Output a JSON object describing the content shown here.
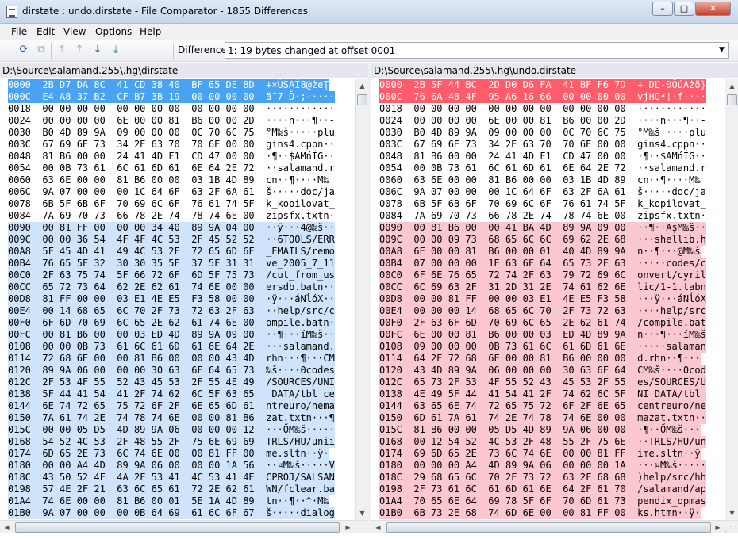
{
  "window": {
    "title": "dirstate : undo.dirstate - File Comparator - 1855 Differences",
    "minimize": "–",
    "maximize": "□",
    "close": "✕"
  },
  "menu": [
    "File",
    "Edit",
    "View",
    "Options",
    "Help"
  ],
  "toolbar": {
    "icons": [
      "refresh-icon",
      "copy-icon",
      "first-difference-icon",
      "previous-difference-icon",
      "next-difference-icon",
      "last-difference-icon"
    ],
    "difference_label": "Difference",
    "difference_value": "1: 19 bytes changed at offset 0001"
  },
  "left": {
    "path": "D:\\Source\\salamand.255\\.hg\\dirstate",
    "rows": [
      "0000  2B D7 DA 8C  41 CD 38 40  BF 65 DE 8D  +×ÚŚAÍ8@żeŢ",
      "000C  E4 A8 37 B2  CF B7 3B 19  00 00 00 00  ä¨7 Ď·;·····",
      "0018  00 00 00 00  00 00 00 00  00 00 00 00  ············",
      "0024  00 00 00 00  6E 00 00 81  B6 00 00 2D  ····n···¶··-",
      "0030  B0 4D 89 9A  09 00 00 00  0C 70 6C 75  °M‰š·····plu",
      "003C  67 69 6E 73  34 2E 63 70  70 6E 00 00  gins4.cppn··",
      "0048  81 B6 00 00  24 41 4D F1  CD 47 00 00  ·¶··$AMńÍG··",
      "0054  00 0B 73 61  6C 61 6D 61  6E 64 2E 72  ··salamand.r",
      "0060  63 6E 00 00  81 B6 00 00  03 1B 4D 89  cn··¶····M‰",
      "006C  9A 07 00 00  00 1C 64 6F  63 2F 6A 61  š·····doc/ja",
      "0078  6B 5F 6B 6F  70 69 6C 6F  76 61 74 5F  k_kopilovat_",
      "0084  7A 69 70 73  66 78 2E 74  78 74 6E 00  zipsfx.txtn·",
      "0090  00 81 FF 00  00 00 34 40  89 9A 04 00  ··ÿ···4@‰š··",
      "009C  00 00 36 54  4F 4F 4C 53  2F 45 52 52  ··6TOOLS/ERR",
      "00A8  5F 45 4D 41  49 4C 53 2F  72 65 6D 6F  _EMAILS/remo",
      "00B4  76 65 5F 32  30 30 35 5F  37 5F 31 31  ve_2005_7_11",
      "00C0  2F 63 75 74  5F 66 72 6F  6D 5F 75 73  /cut_from_us",
      "00CC  65 72 73 64  62 2E 62 61  74 6E 00 00  ersdb.batn··",
      "00D8  81 FF 00 00  03 E1 4E E5  F3 58 00 00  ·ÿ···áNĺóX··",
      "00E4  00 14 68 65  6C 70 2F 73  72 63 2F 63  ··help/src/c",
      "00F0  6F 6D 70 69  6C 65 2E 62  61 74 6E 00  ompile.batn·",
      "00FC  00 81 B6 00  00 03 ED 4D  89 9A 09 00  ··¶···íM‰š··",
      "0108  00 00 0B 73  61 6C 61 6D  61 6E 64 2E  ···salamand.",
      "0114  72 68 6E 00  00 81 B6 00  00 00 43 4D  rhn···¶···CM",
      "0120  89 9A 06 00  00 00 30 63  6F 64 65 73  ‰š····0codes",
      "012C  2F 53 4F 55  52 43 45 53  2F 55 4E 49  /SOURCES/UNI",
      "0138  5F 44 41 54  41 2F 74 62  6C 5F 63 65  _DATA/tbl_ce",
      "0144  6E 74 72 65  75 72 6F 2F  6E 65 6D 61  ntreuro/nema",
      "0150  7A 61 74 2E  74 78 74 6E  00 00 81 B6  zat.txtn···¶",
      "015C  00 00 05 D5  4D 89 9A 06  00 00 00 12  ···ŐM‰š·····",
      "0168  54 52 4C 53  2F 48 55 2F  75 6E 69 69  TRLS/HU/unii",
      "0174  6D 65 2E 73  6C 74 6E 00  00 81 FF 00  me.sltn··ÿ·",
      "0180  00 00 A4 4D  89 9A 06 00  00 00 1A 56  ··¤M‰š·····V",
      "018C  43 50 52 4F  4A 2F 53 41  4C 53 41 4E  CPROJ/SALSAN",
      "0198  57 4E 2F 21  63 6C 65 61  72 2E 62 61  WN/fclear.ba",
      "01A4  74 6E 00 00  81 B6 00 01  5E 1A 4D 89  tn··¶··^·M‰",
      "01B0  9A 07 00 00  00 0B 64 69  61 6C 6F 67  š·····dialog"
    ]
  },
  "right": {
    "path": "D:\\Source\\salamand.255\\.hg\\undo.dirstate",
    "rows": [
      "0000  2B 5F 44 BC  2D D0 D6 FA  41 BF F6 7D  +_DĽ-ĐÖúAżö}",
      "000C  76 6A 48 4F  95 A6 16 66  00 00 00 00  vjHO•¦·f····",
      "0018  00 00 00 00  00 00 00 00  00 00 00 00  ············",
      "0024  00 00 00 00  6E 00 00 81  B6 00 00 2D  ····n···¶··-",
      "0030  B0 4D 89 9A  09 00 00 00  0C 70 6C 75  °M‰š·····plu",
      "003C  67 69 6E 73  34 2E 63 70  70 6E 00 00  gins4.cppn··",
      "0048  81 B6 00 00  24 41 4D F1  CD 47 00 00  ·¶··$AMńÍG··",
      "0054  00 0B 73 61  6C 61 6D 61  6E 64 2E 72  ··salamand.r",
      "0060  63 6E 00 00  81 B6 00 00  03 1B 4D 89  cn··¶····M‰",
      "006C  9A 07 00 00  00 1C 64 6F  63 2F 6A 61  š·····doc/ja",
      "0078  6B 5F 6B 6F  70 69 6C 6F  76 61 74 5F  k_kopilovat_",
      "0084  7A 69 70 73  66 78 2E 74  78 74 6E 00  zipsfx.txtn·",
      "0090  00 81 B6 00  00 41 BA 4D  89 9A 09 00  ··¶··AşM‰š··",
      "009C  00 00 09 73  68 65 6C 6C  69 62 2E 68  ···shellib.h",
      "00A8  6E 00 00 81  B6 00 00 01  40 4D 89 9A  n··¶···@M‰š",
      "00B4  07 00 00 00  1E 63 6F 64  65 73 2F 63  ·····codes/c",
      "00C0  6F 6E 76 65  72 74 2F 63  79 72 69 6C  onvert/cyril",
      "00CC  6C 69 63 2F  31 2D 31 2E  74 61 62 6E  lic/1-1.tabn",
      "00D8  00 00 81 FF  00 00 03 E1  4E E5 F3 58  ···ÿ···áNĺóX",
      "00E4  00 00 00 14  68 65 6C 70  2F 73 72 63  ····help/src",
      "00F0  2F 63 6F 6D  70 69 6C 65  2E 62 61 74  /compile.bat",
      "00FC  6E 00 00 81  B6 00 00 03  ED 4D 89 9A  n···¶···íM‰š",
      "0108  09 00 00 00  0B 73 61 6C  61 6D 61 6E  ·····salaman",
      "0114  64 2E 72 68  6E 00 00 81  B6 00 00 00  d.rhn··¶···",
      "0120  43 4D 89 9A  06 00 00 00  30 63 6F 64  CM‰š····0cod",
      "012C  65 73 2F 53  4F 55 52 43  45 53 2F 55  es/SOURCES/U",
      "0138  4E 49 5F 44  41 54 41 2F  74 62 6C 5F  NI_DATA/tbl_",
      "0144  63 65 6E 74  72 65 75 72  6F 2F 6E 65  centreuro/ne",
      "0150  6D 61 7A 61  74 2E 74 78  74 6E 00 00  mazat.txtn··",
      "015C  81 B6 00 00  05 D5 4D 89  9A 06 00 00  ·¶··ŐM‰š···",
      "0168  00 12 54 52  4C 53 2F 48  55 2F 75 6E  ··TRLS/HU/un",
      "0174  69 6D 65 2E  73 6C 74 6E  00 00 81 FF  ime.sltn··ÿ",
      "0180  00 00 00 A4  4D 89 9A 06  00 00 00 1A  ···¤M‰š·····",
      "018C  29 68 65 6C  70 2F 73 72  63 2F 68 68  )help/src/hh",
      "0198  2F 73 61 6C  61 6D 61 6E  64 2F 61 70  /salamand/ap",
      "01A4  70 65 6E 64  69 78 5F 6F  70 6D 61 73  pendix_opmas",
      "01B0  6B 73 2E 68  74 6D 6E 00  00 81 FF 00  ks.htmn··ÿ·"
    ]
  }
}
